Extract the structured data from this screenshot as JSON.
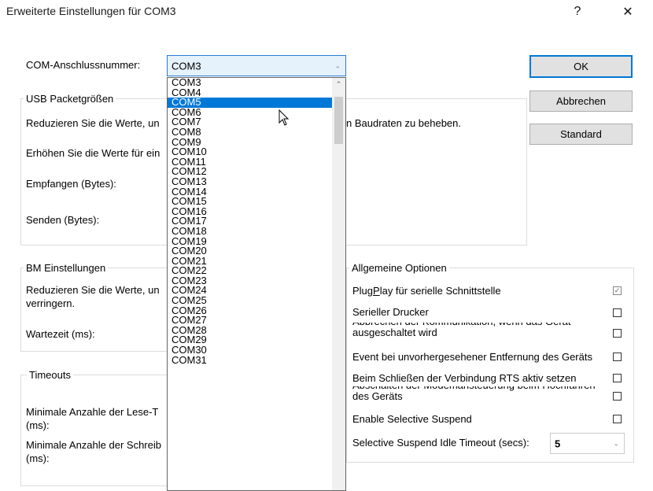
{
  "window": {
    "title": "Erweiterte Einstellungen für COM3",
    "help_glyph": "?",
    "close_glyph": "✕"
  },
  "com_port": {
    "label": "COM-Anschlussnummer:",
    "value": "COM3",
    "options": [
      "COM3",
      "COM4",
      "COM5",
      "COM6",
      "COM7",
      "COM8",
      "COM9",
      "COM10",
      "COM11",
      "COM12",
      "COM13",
      "COM14",
      "COM15",
      "COM16",
      "COM17",
      "COM18",
      "COM19",
      "COM20",
      "COM21",
      "COM22",
      "COM23",
      "COM24",
      "COM25",
      "COM26",
      "COM27",
      "COM28",
      "COM29",
      "COM30",
      "COM31"
    ],
    "highlighted": "COM5"
  },
  "buttons": {
    "ok": "OK",
    "cancel": "Abbrechen",
    "default": "Standard"
  },
  "usb": {
    "title": "USB Packetgrößen",
    "desc_left": "Reduzieren Sie die Werte, un",
    "desc_right": "n Baudraten zu beheben.",
    "increase": "Erhöhen Sie die Werte für ein",
    "receive": "Empfangen (Bytes):",
    "send": "Senden (Bytes):"
  },
  "bm": {
    "title": "BM Einstellungen",
    "desc_line1": "Reduzieren Sie die Werte, un",
    "desc_line2": "verringern.",
    "latency": "Wartezeit (ms):"
  },
  "timeouts": {
    "title": "Timeouts",
    "min_read_1": "Minimale Anzahle der Lese-T",
    "min_read_2": "(ms):",
    "min_write_1": "Minimale Anzahle der Schreib",
    "min_write_2": "(ms):"
  },
  "general": {
    "title": "Allgemeine Optionen",
    "options": [
      {
        "label": "PlugPlay für serielle Schnittstelle",
        "checked": true
      },
      {
        "label": "Serieller Drucker",
        "checked": false
      },
      {
        "label": "Abbrechen der Kommunikation, wenn das Gerät ausgeschaltet wird",
        "checked": false
      },
      {
        "label": "Event bei unvorhergesehener Entfernung des Geräts",
        "checked": false
      },
      {
        "label": "Beim Schließen der Verbindung RTS aktiv setzen",
        "checked": false
      },
      {
        "label": "Abschalten der Modemansteuerung beim Hochfahren des Geräts",
        "checked": false
      },
      {
        "label": "Enable Selective Suspend",
        "checked": false
      }
    ],
    "idle_label": "Selective Suspend Idle Timeout (secs):",
    "idle_value": "5"
  },
  "icons": {
    "combo_arrow": "chevron-down-icon",
    "scroll_up": "chevron-up-icon",
    "check": "checkmark-icon",
    "pointer": "mouse-pointer-icon"
  }
}
